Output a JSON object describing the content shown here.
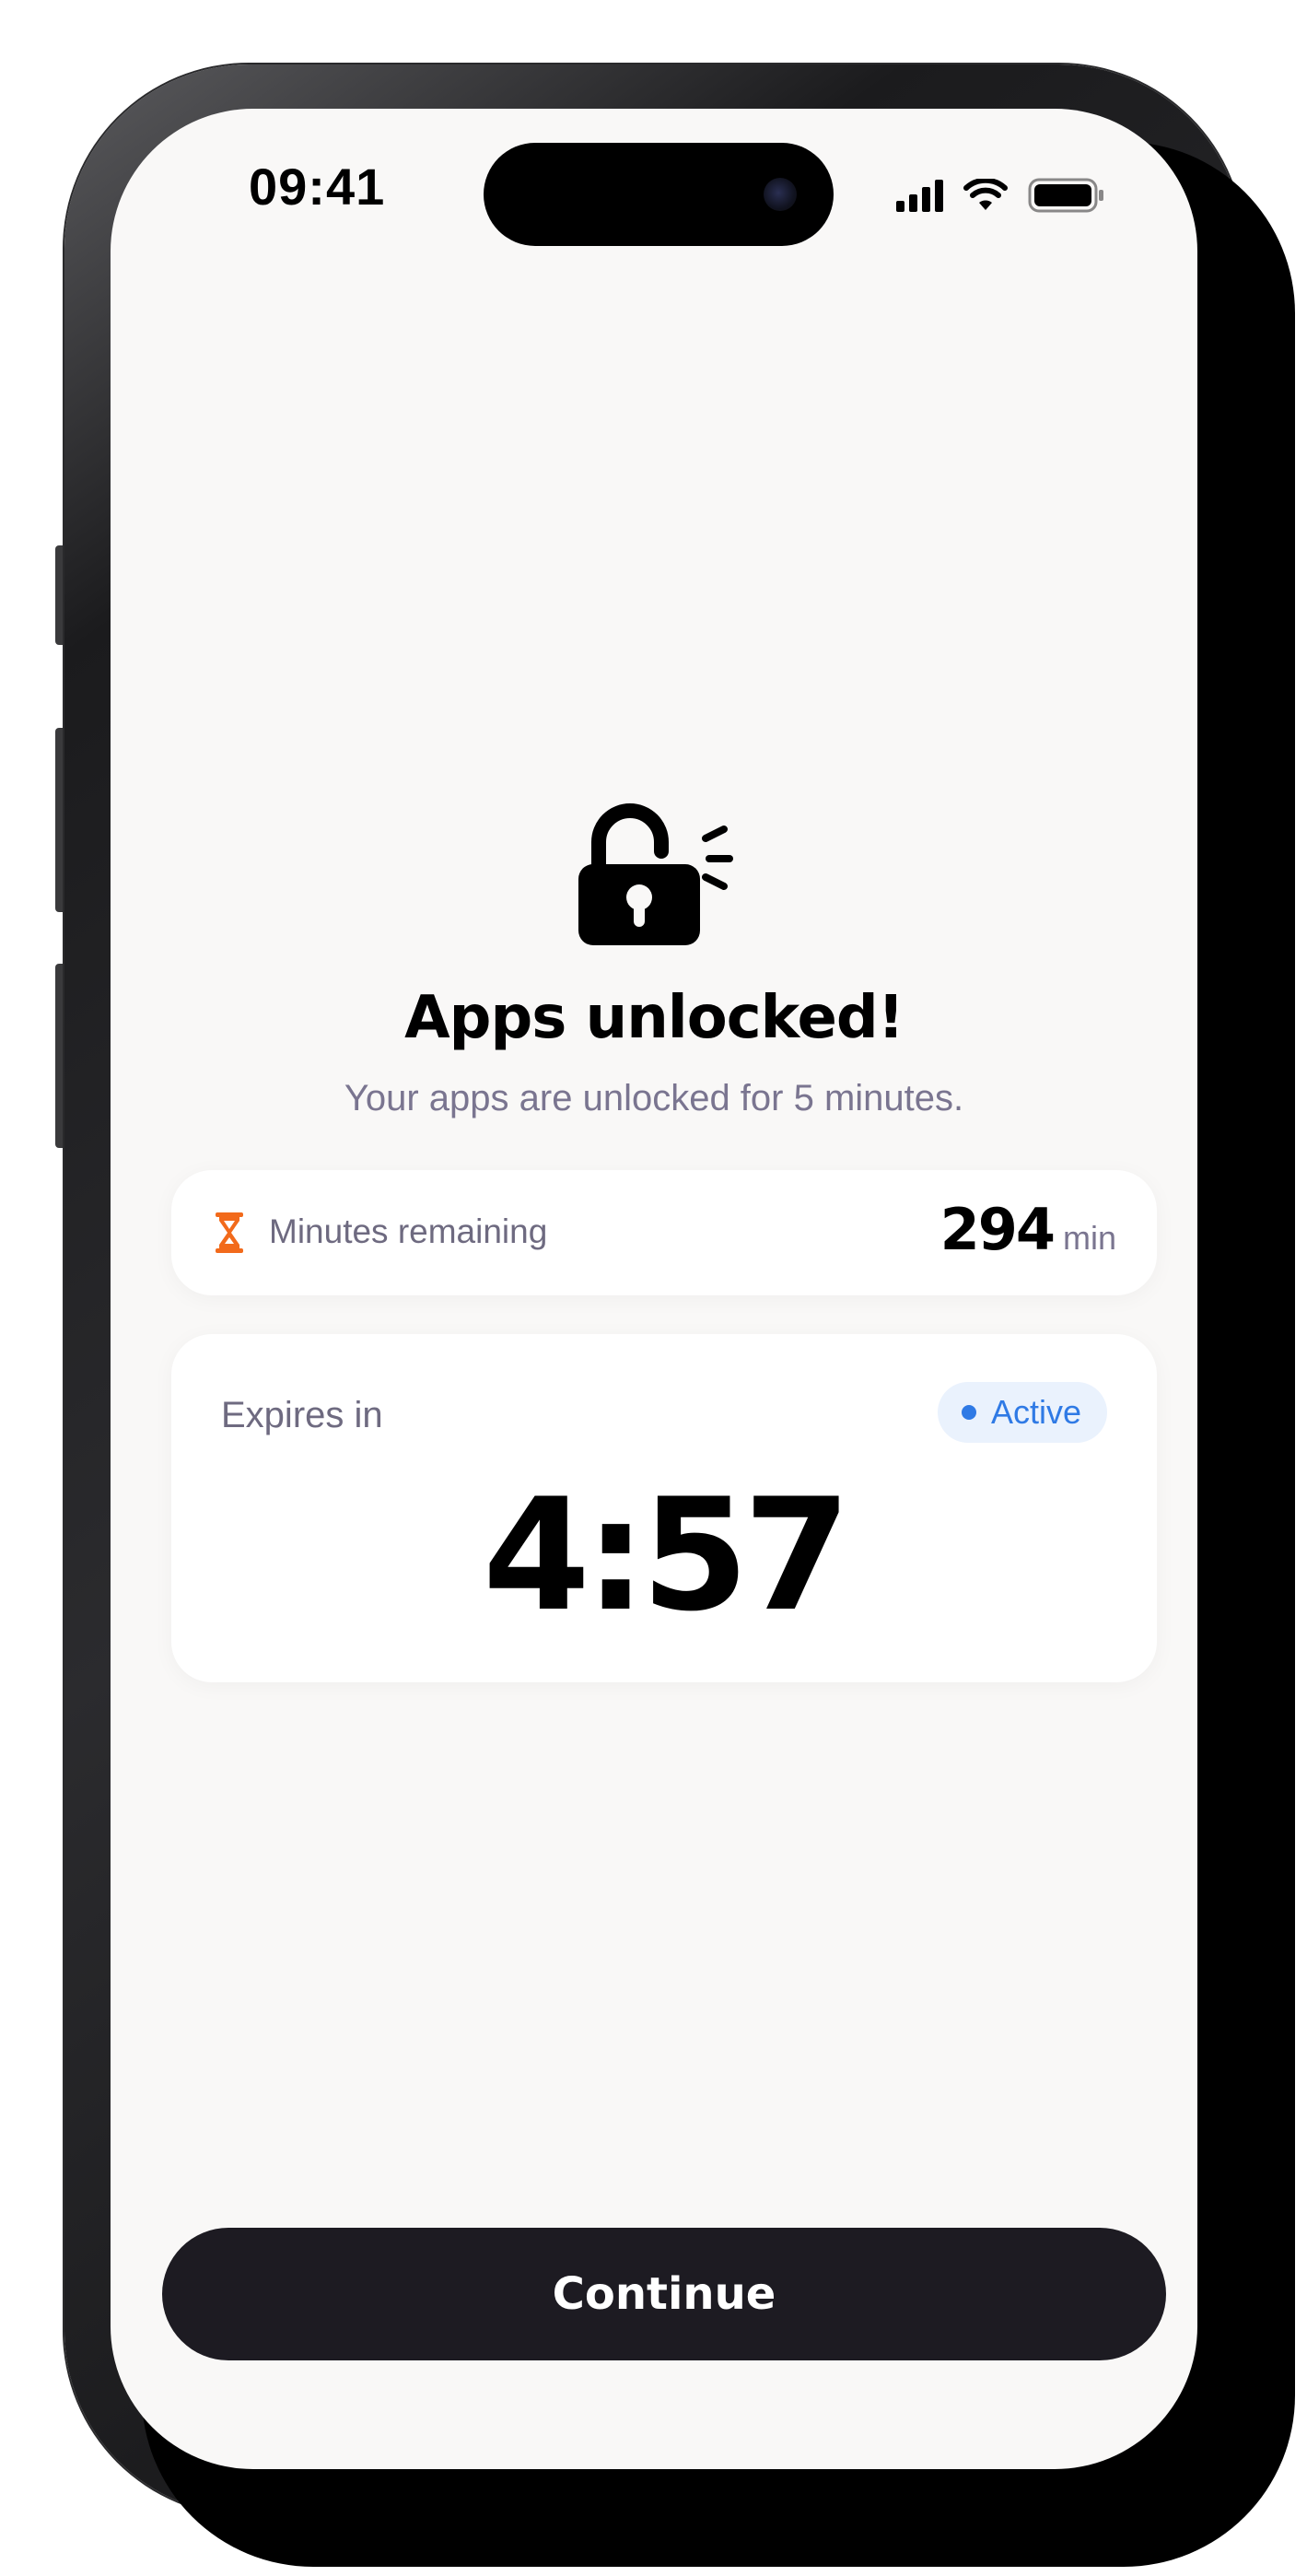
{
  "status_bar": {
    "time": "09:41"
  },
  "icons": {
    "lock": "unlocked-padlock-icon",
    "timer": "hourglass-icon",
    "signal": "cellular-signal-icon",
    "wifi": "wifi-icon",
    "battery": "battery-icon"
  },
  "main": {
    "title": "Apps unlocked!",
    "subtitle": "Your apps are unlocked for 5 minutes."
  },
  "minutes_card": {
    "label": "Minutes remaining",
    "value": "294",
    "unit": "min"
  },
  "expires_card": {
    "label": "Expires in",
    "status": "Active",
    "countdown": "4:57"
  },
  "actions": {
    "continue_label": "Continue"
  },
  "colors": {
    "screen_background": "#f9f8f7",
    "accent_orange": "#f26a1b",
    "active_blue": "#2f7ae5",
    "button_dark": "#1d1b22"
  }
}
